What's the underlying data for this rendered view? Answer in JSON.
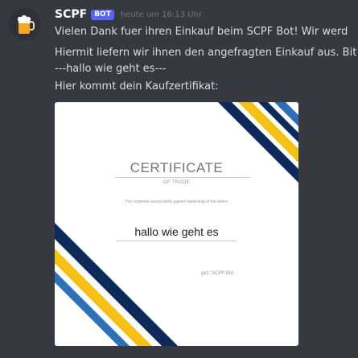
{
  "message": {
    "author": "SCPF",
    "tag": "BOT",
    "timestamp": "heute um 16:13 Uhr",
    "lines": [
      "Vielen Dank fuer ihren Einkauf beim SCPF Bot! Wir werd",
      "Hiermit liefern wir ihnen den angefragten Einkauf aus. Bit",
      "---hallo wie geht es---",
      "Hier kommt dein Kaufzertifikat:"
    ]
  },
  "certificate": {
    "title": "CERTIFICATE",
    "subtitle": "OF TRADE",
    "description": "The customer successfully gained ownership of the letters",
    "text": "hallo wie geht es",
    "signature": "gez. SCPF-Bot"
  },
  "colors": {
    "background": "#36393f",
    "bot_tag": "#5865f2",
    "stripe_navy": "#0d2a5a",
    "stripe_yellow": "#f5c116",
    "stripe_blue": "#2e6fb8"
  },
  "icons": {
    "avatar": "beer-mug-icon"
  }
}
